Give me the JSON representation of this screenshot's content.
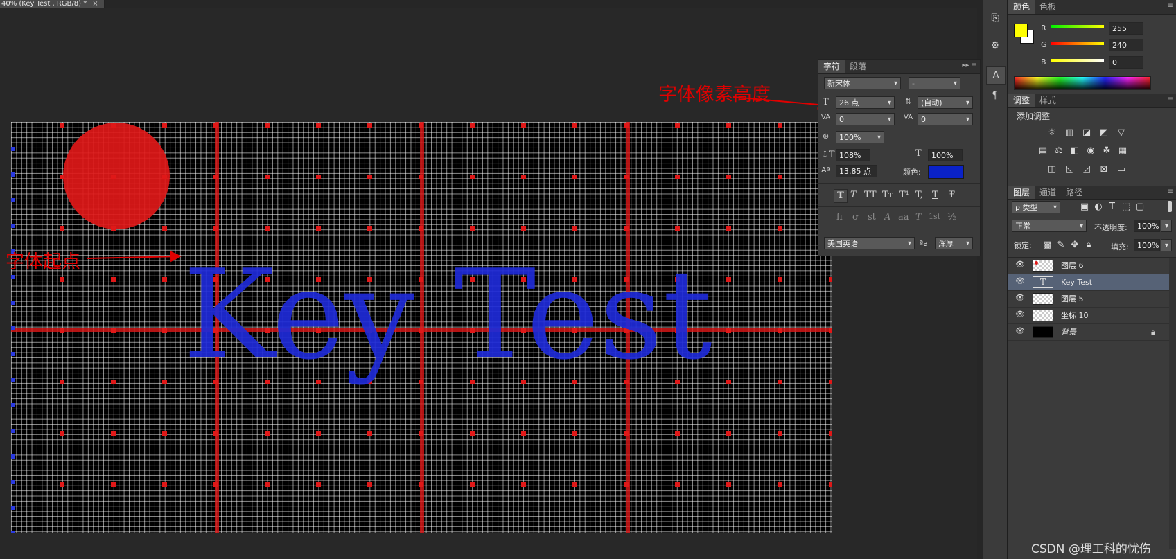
{
  "document": {
    "tab_title": "40% (Key Test , RGB/8) *",
    "close_glyph": "×"
  },
  "canvas": {
    "text": "Key Test",
    "text_color": "#1f2bd8",
    "circle_color": "#e01818",
    "grid_color": "#ffffff"
  },
  "annotations": {
    "font_pixel_height": "字体像素高度",
    "font_origin": "字体起点",
    "arrow_color": "#e00000"
  },
  "toolstrip": {
    "items": [
      "history-icon",
      "properties-icon",
      "character-icon",
      "paragraph-icon"
    ]
  },
  "color_panel": {
    "tabs": [
      "颜色",
      "色板"
    ],
    "fg_color": "#ffff00",
    "bg_color": "#ffffff",
    "channels": [
      {
        "label": "R",
        "value": "255"
      },
      {
        "label": "G",
        "value": "240"
      },
      {
        "label": "B",
        "value": "0"
      }
    ]
  },
  "character_panel": {
    "tabs": [
      "字符",
      "段落"
    ],
    "font_family": "新宋体",
    "font_style": "-",
    "font_size": "26 点",
    "leading": "(自动)",
    "kerning": "0",
    "tracking": "0",
    "tsume": "100%",
    "vertical_scale": "108%",
    "horizontal_scale": "100%",
    "baseline_shift": "13.85 点",
    "color_label": "颜色:",
    "text_color": "#0a22c8",
    "style_buttons": [
      "T",
      "T",
      "TT",
      "Tт",
      "T¹",
      "T,",
      "T",
      "Ŧ"
    ],
    "opentype_buttons": [
      "fi",
      "ơ",
      "st",
      "A",
      "aa",
      "T",
      "1st",
      "½"
    ],
    "language": "美国英语",
    "aa_label": "ªa",
    "antialias": "浑厚"
  },
  "adjustments_panel": {
    "tabs": [
      "调整",
      "样式"
    ],
    "title": "添加调整"
  },
  "layers_panel": {
    "tabs": [
      "图层",
      "通道",
      "路径"
    ],
    "filter": "ρ 类型",
    "blend_mode": "正常",
    "opacity_label": "不透明度:",
    "opacity": "100%",
    "lock_label": "锁定:",
    "fill_label": "填充:",
    "fill": "100%",
    "layers": [
      {
        "name": "图层 6",
        "selected": false
      },
      {
        "name": "Key Test",
        "selected": true
      },
      {
        "name": "图层 5",
        "selected": false
      },
      {
        "name": "坐标 10",
        "selected": false
      },
      {
        "name": "背景",
        "selected": false
      }
    ]
  },
  "watermark": "CSDN @理工科的忧伤"
}
